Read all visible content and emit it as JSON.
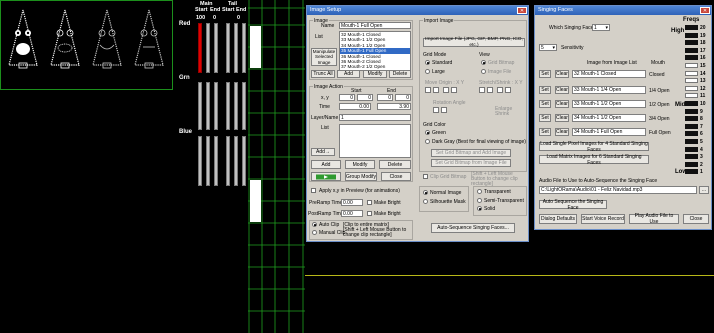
{
  "channels": {
    "headers": [
      "Main",
      "Start",
      "Tail",
      "Start",
      "End",
      "End"
    ],
    "values": [
      "100",
      "0",
      "0"
    ],
    "row_labels": [
      "Red",
      "Grn",
      "Blue"
    ]
  },
  "image_setup": {
    "title": "Image Setup",
    "image_group": "Image",
    "name_label": "Name",
    "name_value": "Mouth-1 Full Open",
    "list_label": "List",
    "list_items": [
      "32 Mouth-1 Closed",
      "33 Mouth-1 1/2 Open",
      "34 Mouth-1 1/2 Open",
      "35 Mouth-1 Full Open",
      "36 Mouth-1 Closed",
      "36 Mouth-2 Closed",
      "37 Mouth-2 1/2 Open"
    ],
    "manipulate_label": "Manipulate Selected Image",
    "trunc_all": "Trunc All",
    "add": "Add",
    "modify": "Modify",
    "delete": "Delete",
    "image_action": "Image Action",
    "xy_label": "x, y",
    "start_label": "Start",
    "end_label": "End",
    "start_x": "0",
    "start_y": "0",
    "end_x": "0",
    "end_y": "0",
    "time_label": "Time",
    "time_start": "0.00",
    "time_end": "3.90",
    "layer_label": "Layer/Name",
    "layer_value": "1",
    "list2_label": "List",
    "add_arrow": "Add→",
    "add2": "Add",
    "modify2": "Modify",
    "delete2": "Delete",
    "group_modify": "Group Modify",
    "close": "Close",
    "apply_xy": "Apply x,y in Preview (for animations)",
    "preramp": "PreRamp Time:",
    "preramp_val": "0.00",
    "postramp": "PostRamp Time:",
    "postramp_val": "0.00",
    "make_bright": "Make Bright",
    "make_bright2": "Make Bright",
    "auto_clip": "Auto Clip",
    "auto_clip_note": "[Clip to entire matrix]",
    "manual_clip": "Manual Clip",
    "manual_clip_note": "[Shift + Left Mouse Button to change clip rectangle]",
    "import_group": "Import Image",
    "import_btn": "Import Image File (JPG, GIF, BMP, PNG, ICO, etc.)",
    "grid_mode": "Grid Mode",
    "standard": "Standard",
    "large": "Large",
    "view": "View",
    "grid_bitmap": "Grid Bitmap",
    "image_file": "Image File",
    "move_origin": "Move Origin : X  Y",
    "stretch_shrink": "Stretch/Shrink : X  Y",
    "rotation_angle": "Rotation Angle",
    "enlarge_shrink": "Enlarge Shrink",
    "grid_color": "Grid Color",
    "green": "Green",
    "dark_gray": "Dark Gray (Best for final viewing of image)",
    "set_grid_bitmap_add": "Set Grid Bitmap and Add Image",
    "set_grid_bitmap_from": "Set Grid Bitmap from Image File",
    "clip_grid_bitmap": "Clip Grid Bitmap",
    "clip_note": "[Shift + Left Mouse Button to change clip rectangle]",
    "normal_image": "Normal Image",
    "silhouette_mask": "Silhouette Mask",
    "transparent": "Transparent",
    "semi_transparent": "Semi-Transparent",
    "solid": "Solid",
    "auto_seq": "Auto-Sequence Singing Faces..."
  },
  "singing_faces": {
    "title": "Singing Faces",
    "which_label": "Which Singing Face?",
    "which_value": "1",
    "freqs": "Freqs",
    "high": "High",
    "mid": "Mid",
    "low": "Low",
    "sensitivity_value": "5",
    "sensitivity_label": "Sensitivity",
    "image_from_list": "Image from Image List",
    "mouth": "Mouth",
    "rows": [
      {
        "set": "Set",
        "clear": "Clear",
        "value": "32 Mouth-1 Closed",
        "mouth": "Closed"
      },
      {
        "set": "Set",
        "clear": "Clear",
        "value": "33 Mouth-1 1/4 Open",
        "mouth": "1/4 Open"
      },
      {
        "set": "Set",
        "clear": "Clear",
        "value": "33 Mouth-1 1/2 Open",
        "mouth": "1/2 Open"
      },
      {
        "set": "Set",
        "clear": "Clear",
        "value": "34 Mouth-1 1/2 Open",
        "mouth": "3/4 Open"
      },
      {
        "set": "Set",
        "clear": "Clear",
        "value": "34 Mouth-1 Full Open",
        "mouth": "Full Open"
      }
    ],
    "freq_numbers": [
      "20",
      "19",
      "18",
      "17",
      "16",
      "15",
      "14",
      "13",
      "12",
      "11",
      "10",
      "9",
      "8",
      "7",
      "6",
      "5",
      "4",
      "3",
      "2",
      "1"
    ],
    "load_single": "Load Single Pixel Images for 4 Standard Singing Faces",
    "load_matrix": "Load Matrix Images for 6 Standard Singing Faces",
    "audio_label": "Audio File to Use to Auto-Sequence the Singing Face",
    "audio_path": "C:\\LightORama\\Audio\\01 - Feliz Navidad.mp3",
    "browse": "...",
    "auto_seq": "Auto Sequence the Singing Face",
    "dialog_defaults": "Dialog Defaults",
    "start_voice": "Start Voice Record",
    "play_audio": "Play Audio File to Use",
    "close": "Close"
  }
}
